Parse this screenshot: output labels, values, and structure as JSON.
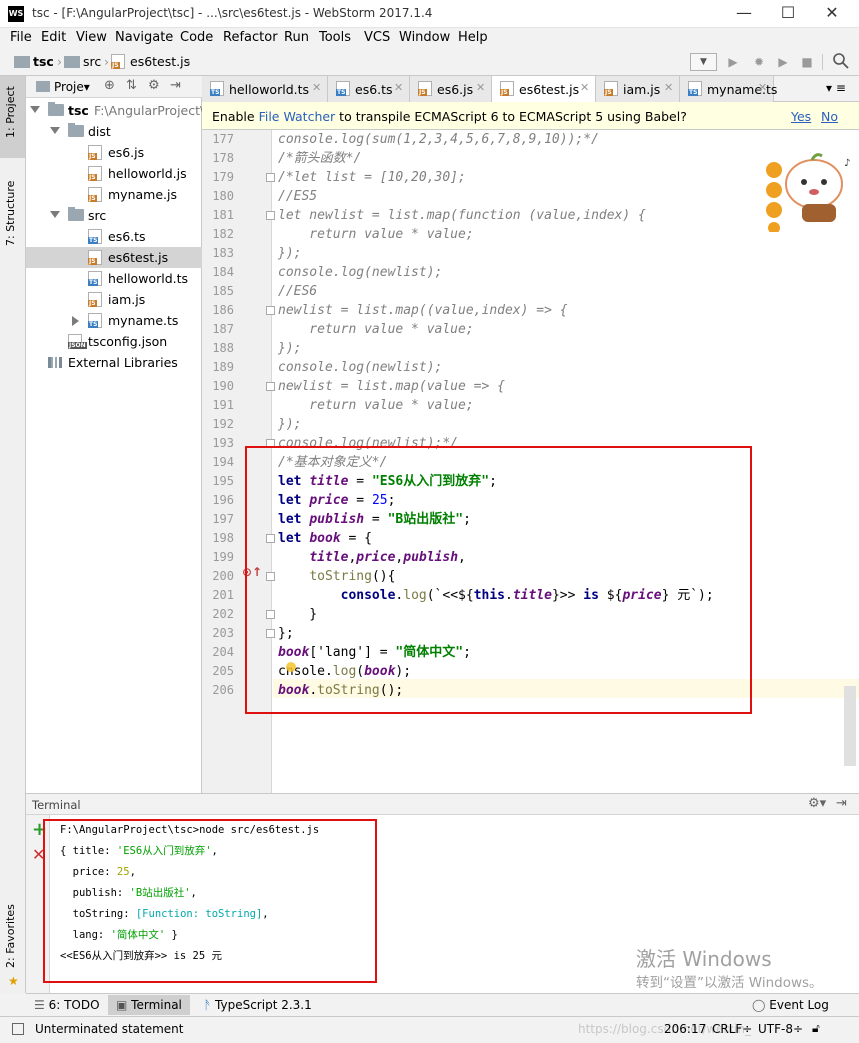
{
  "window": {
    "logo": "WS",
    "title": "tsc - [F:\\AngularProject\\tsc] - ...\\src\\es6test.js - WebStorm 2017.1.4"
  },
  "menu": [
    "File",
    "Edit",
    "View",
    "Navigate",
    "Code",
    "Refactor",
    "Run",
    "Tools",
    "VCS",
    "Window",
    "Help"
  ],
  "breadcrumb": [
    "tsc",
    "src",
    "es6test.js"
  ],
  "left_strip": {
    "project": "1: Project",
    "structure": "7: Structure",
    "favorites": "2: Favorites"
  },
  "project": {
    "header": "Proje▾",
    "tree": [
      {
        "label": "tsc",
        "extra": "F:\\AngularProject\\t",
        "icon": "folder",
        "arrow": "down",
        "indent": 0,
        "bold": true
      },
      {
        "label": "dist",
        "icon": "folder",
        "arrow": "down",
        "indent": 1
      },
      {
        "label": "es6.js",
        "icon": "js",
        "indent": 2
      },
      {
        "label": "helloworld.js",
        "icon": "js",
        "indent": 2
      },
      {
        "label": "myname.js",
        "icon": "js",
        "indent": 2
      },
      {
        "label": "src",
        "icon": "folder",
        "arrow": "down",
        "indent": 1
      },
      {
        "label": "es6.ts",
        "icon": "ts",
        "indent": 2
      },
      {
        "label": "es6test.js",
        "icon": "js",
        "indent": 2,
        "selected": true
      },
      {
        "label": "helloworld.ts",
        "icon": "ts",
        "indent": 2
      },
      {
        "label": "iam.js",
        "icon": "js",
        "indent": 2
      },
      {
        "label": "myname.ts",
        "icon": "ts",
        "arrow": "right",
        "indent": 2
      },
      {
        "label": "tsconfig.json",
        "icon": "json",
        "indent": 1
      },
      {
        "label": "External Libraries",
        "icon": "lib",
        "indent": 0
      }
    ]
  },
  "tabs": [
    {
      "label": "helloworld.ts",
      "icon": "ts"
    },
    {
      "label": "es6.ts",
      "icon": "ts"
    },
    {
      "label": "es6.js",
      "icon": "js"
    },
    {
      "label": "es6test.js",
      "icon": "js",
      "active": true
    },
    {
      "label": "iam.js",
      "icon": "js"
    },
    {
      "label": "myname.ts",
      "icon": "ts"
    }
  ],
  "tabs_overflow": "≡",
  "notification": {
    "prefix": "Enable ",
    "link": "File Watcher",
    "suffix": " to transpile ECMAScript 6 to ECMAScript 5 using Babel?",
    "yes": "Yes",
    "no": "No"
  },
  "editor": {
    "line_numbers": [
      "177",
      "178",
      "179",
      "180",
      "181",
      "182",
      "183",
      "184",
      "185",
      "186",
      "187",
      "188",
      "189",
      "190",
      "191",
      "192",
      "193",
      "194",
      "195",
      "196",
      "197",
      "198",
      "199",
      "200",
      "201",
      "202",
      "203",
      "204",
      "205",
      "206"
    ],
    "code": {
      "l177": "console.log(sum(1,2,3,4,5,6,7,8,9,10));*/",
      "l178": "/*箭头函数*/",
      "l179": "/*let list = [10,20,30];",
      "l180": "//ES5",
      "l181": "let newlist = list.map(function (value,index) {",
      "l182": "    return value * value;",
      "l183": "});",
      "l184": "console.log(newlist);",
      "l185": "//ES6",
      "l186": "newlist = list.map((value,index) => {",
      "l187": "    return value * value;",
      "l188": "});",
      "l189": "console.log(newlist);",
      "l190": "newlist = list.map(value => {",
      "l191": "    return value * value;",
      "l192": "});",
      "l193": "console.log(newlist);*/",
      "l194": "/*基本对象定义*/",
      "l195": {
        "kw": "let",
        "var": "title",
        "op": " = ",
        "str": "\"ES6从入门到放弃\"",
        "end": ";"
      },
      "l196": {
        "kw": "let",
        "var": "price",
        "op": " = ",
        "num": "25",
        "end": ";"
      },
      "l197": {
        "kw": "let",
        "var": "publish",
        "op": " = ",
        "str": "\"B站出版社\"",
        "end": ";"
      },
      "l198": {
        "kw": "let",
        "var": "book",
        "op": " = {"
      },
      "l199": {
        "a": "title",
        "b": "price",
        "c": "publish"
      },
      "l200": {
        "fn": "toString",
        "rest": "(){"
      },
      "l201": {
        "obj": "console",
        "dot": ".",
        "fn": "log",
        "open": "(`<<${",
        "this": "this",
        "prop": "title",
        "mid": "}>> ",
        "is": "is",
        "mid2": " ${",
        "var": "price",
        "close": "} 元`);"
      },
      "l202": "}",
      "l203": "};",
      "l204": {
        "var": "book",
        "mid": "['lang'] = ",
        "str": "\"简体中文\"",
        "end": ";"
      },
      "l205": {
        "a": "c",
        "b": "nsole",
        "dot": ".",
        "fn": "log",
        "open": "(",
        "var": "book",
        "close": ");"
      },
      "l206": {
        "var": "book",
        "dot": ".",
        "fn": "toString",
        "close": "();"
      }
    }
  },
  "terminal": {
    "header": "Terminal",
    "lines": {
      "cmd": "F:\\AngularProject\\tsc>node src/es6test.js",
      "o1a": "{ title: ",
      "o1b": "'ES6从入门到放弃'",
      "o1c": ",",
      "o2a": "  price: ",
      "o2b": "25",
      "o2c": ",",
      "o3a": "  publish: ",
      "o3b": "'B站出版社'",
      "o3c": ",",
      "o4a": "  toString: ",
      "o4b": "[Function: toString]",
      "o4c": ",",
      "o5a": "  lang: ",
      "o5b": "'简体中文'",
      "o5c": " }",
      "o6": "<<ES6从入门到放弃>> is 25 元"
    }
  },
  "watermark": {
    "line1": "激活 Windows",
    "line2": "转到“设置”以激活 Windows。"
  },
  "bottom_tabs": {
    "todo": "6: TODO",
    "terminal": "Terminal",
    "typescript": "TypeScript 2.3.1",
    "eventlog": "Event Log"
  },
  "status": {
    "message": "Unterminated statement",
    "position": "206:17",
    "line_sep": "CRLF÷",
    "encoding": "UTF-8÷",
    "url_watermark": "https://blog.csdn.net/weixin_"
  },
  "colors": {
    "accent": "#3b7ec1",
    "highlight_box": "#e01010",
    "string": "#008000",
    "keyword": "#000080"
  }
}
